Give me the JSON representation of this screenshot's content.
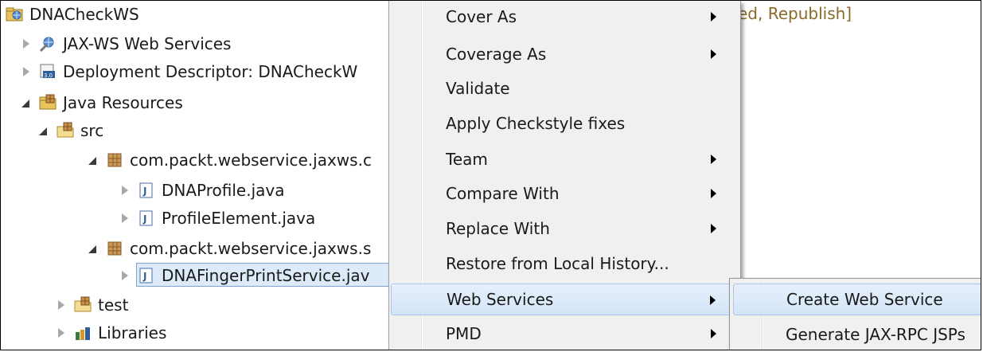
{
  "tree": {
    "items": [
      {
        "label": "DNACheckWS",
        "icon": "web-project-icon",
        "state": "none"
      },
      {
        "label": "JAX-WS Web Services",
        "icon": "web-services-icon",
        "state": "collapsed"
      },
      {
        "label": "Deployment Descriptor: DNACheckW",
        "icon": "deployment-descriptor-icon",
        "state": "collapsed"
      },
      {
        "label": "Java Resources",
        "icon": "java-resources-icon",
        "state": "expanded"
      },
      {
        "label": "src",
        "icon": "source-folder-icon",
        "state": "expanded"
      },
      {
        "label": "com.packt.webservice.jaxws.c",
        "icon": "package-icon",
        "state": "expanded"
      },
      {
        "label": "DNAProfile.java",
        "icon": "java-file-icon",
        "state": "collapsed"
      },
      {
        "label": "ProfileElement.java",
        "icon": "java-file-icon",
        "state": "collapsed"
      },
      {
        "label": "com.packt.webservice.jaxws.s",
        "icon": "package-icon",
        "state": "expanded"
      },
      {
        "label": "DNAFingerPrintService.jav",
        "icon": "java-file-icon",
        "state": "collapsed"
      },
      {
        "label": "test",
        "icon": "source-folder-icon",
        "state": "collapsed"
      },
      {
        "label": "Libraries",
        "icon": "libraries-icon",
        "state": "collapsed"
      }
    ],
    "server_status": "ed, Republish]"
  },
  "context_menu": {
    "items": [
      {
        "label": "Cover As",
        "submenu": true
      },
      {
        "label": "Coverage As",
        "submenu": true
      },
      {
        "label": "Validate",
        "submenu": false
      },
      {
        "label": "Apply Checkstyle fixes",
        "submenu": false
      },
      {
        "label": "Team",
        "submenu": true
      },
      {
        "label": "Compare With",
        "submenu": true
      },
      {
        "label": "Replace With",
        "submenu": true
      },
      {
        "label": "Restore from Local History...",
        "submenu": false
      },
      {
        "label": "Web Services",
        "submenu": true
      },
      {
        "label": "PMD",
        "submenu": true
      }
    ],
    "highlighted": "Web Services"
  },
  "submenu": {
    "items": [
      {
        "label": "Create Web Service"
      },
      {
        "label": "Generate JAX-RPC JSPs"
      }
    ],
    "highlighted": "Create Web Service"
  },
  "colors": {
    "selection_fill": "#dceaf9",
    "selection_border": "#7da2ce",
    "menu_bg": "#f0f0f0",
    "hover_fill": "#d3e4f8",
    "status_text": "#8a6a2a"
  }
}
